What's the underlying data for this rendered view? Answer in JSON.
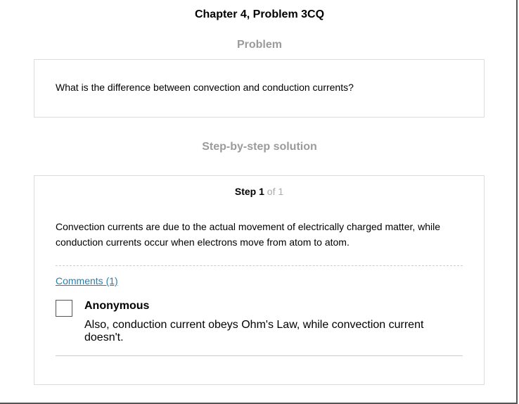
{
  "header": {
    "title": "Chapter 4, Problem 3CQ"
  },
  "problem": {
    "heading": "Problem",
    "text": "What is the difference between convection and conduction currents?"
  },
  "solution": {
    "heading": "Step-by-step solution",
    "step": {
      "word": "Step",
      "number": "1",
      "of_total": "of 1"
    },
    "text": "Convection currents are due to the actual movement of electrically charged matter, while conduction currents occur when electrons move from atom to atom."
  },
  "comments": {
    "link_label": "Comments (1)",
    "items": [
      {
        "author": "Anonymous",
        "text": "Also, conduction current obeys Ohm's Law, while convection current doesn't."
      }
    ]
  },
  "colors": {
    "heading_gray": "#9b9b9b",
    "link_blue": "#2c7fa8",
    "border": "#dddddd"
  }
}
